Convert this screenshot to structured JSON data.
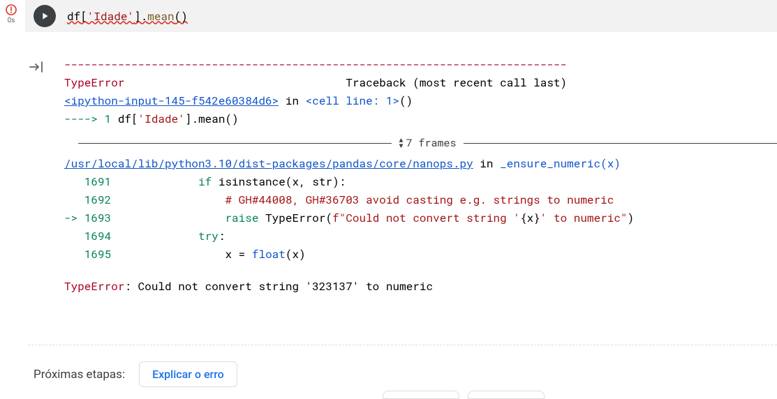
{
  "gutter": {
    "exec_time": "0s"
  },
  "code_cell": {
    "tokens": {
      "df": "df",
      "open": "[",
      "str": "'Idade'",
      "close": "]",
      "dot": ".",
      "method": "mean",
      "parens": "()"
    }
  },
  "traceback": {
    "dashes": "---------------------------------------------------------------------------",
    "error_name": "TypeError",
    "error_name_pad": "                                 ",
    "header_tail": "Traceback (most recent call last)",
    "input_link": "<ipython-input-145-f542e60384d6>",
    "in": " in ",
    "cell_line": "<cell line: 1>",
    "cell_tail": "()",
    "arrow_line": "----> 1 ",
    "arrow_code_pre": "df[",
    "arrow_code_str": "'Idade'",
    "arrow_code_mid": "]",
    "arrow_code_dot": ".",
    "arrow_code_method": "mean",
    "arrow_code_tail": "()",
    "frames_label": "7 frames",
    "file_link": "/usr/local/lib/python3.10/dist-packages/pandas/core/nanops.py",
    "file_in": " in ",
    "file_func": "_ensure_numeric",
    "file_arg": "(x)",
    "l1691_n": "   1691 ",
    "l1691_a": "            ",
    "l1691_kw": "if",
    "l1691_b": " isinstance(x, str):",
    "l1692_n": "   1692 ",
    "l1692_a": "                ",
    "l1692_c": "# GH#44008, GH#36703 avoid casting e.g. strings to numeric",
    "l1693_arrow": "-> ",
    "l1693_n": "1693 ",
    "l1693_a": "                ",
    "l1693_kw": "raise",
    "l1693_sp": " ",
    "l1693_type": "TypeError",
    "l1693_p1": "(",
    "l1693_f": "f\"Could not convert string '",
    "l1693_x1": "{",
    "l1693_x2": "x",
    "l1693_x3": "}",
    "l1693_f2": "' to numeric\"",
    "l1693_p2": ")",
    "l1694_n": "   1694 ",
    "l1694_a": "            ",
    "l1694_kw": "try",
    "l1694_t": ":",
    "l1695_n": "   1695 ",
    "l1695_a": "                x ",
    "l1695_eq": "=",
    "l1695_sp": " ",
    "l1695_fn": "float",
    "l1695_t": "(x)",
    "final_err": "TypeError",
    "final_msg": ": Could not convert string '323137' to numeric"
  },
  "next_steps": {
    "label": "Próximas etapas:",
    "explain": "Explicar o erro"
  }
}
